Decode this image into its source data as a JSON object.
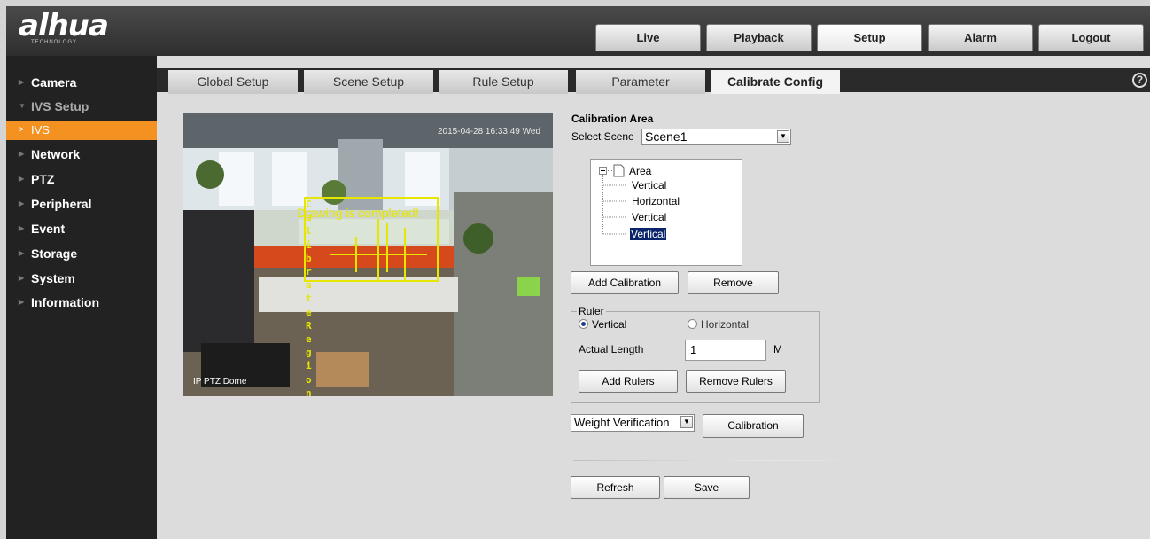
{
  "brand": {
    "logo": "alhua",
    "logo_sub": "TECHNOLOGY"
  },
  "top_nav": [
    "Live",
    "Playback",
    "Setup",
    "Alarm",
    "Logout"
  ],
  "top_nav_active": "Setup",
  "sidebar": {
    "items": [
      {
        "label": "Camera"
      },
      {
        "label": "IVS Setup"
      },
      {
        "label": "IVS"
      },
      {
        "label": "Network"
      },
      {
        "label": "PTZ"
      },
      {
        "label": "Peripheral"
      },
      {
        "label": "Event"
      },
      {
        "label": "Storage"
      },
      {
        "label": "System"
      },
      {
        "label": "Information"
      }
    ]
  },
  "sub_tabs": [
    "Global Setup",
    "Scene Setup",
    "Rule Setup",
    "Parameter",
    "Calibrate Config"
  ],
  "sub_tab_active": "Calibrate Config",
  "video": {
    "timestamp": "2015-04-28 16:33:49 Wed",
    "camera_label": "IP PTZ Dome",
    "overlay_message": "Drawing is completed!",
    "vertical_text": "Calibrate Region"
  },
  "calibration": {
    "title": "Calibration Area",
    "scene_label": "Select Scene",
    "scene_value": "Scene1",
    "tree": {
      "root": "Area",
      "children": [
        "Vertical",
        "Horizontal",
        "Vertical",
        "Vertical"
      ]
    },
    "add_calibration": "Add Calibration",
    "remove": "Remove"
  },
  "ruler": {
    "legend": "Ruler",
    "vertical": "Vertical",
    "horizontal": "Horizontal",
    "selected": "Vertical",
    "length_label": "Actual Length",
    "length_value": "1",
    "unit": "M",
    "add_rulers": "Add Rulers",
    "remove_rulers": "Remove Rulers"
  },
  "verification": {
    "mode": "Weight Verification",
    "calibration_button": "Calibration"
  },
  "footer": {
    "refresh": "Refresh",
    "save": "Save"
  },
  "colors": {
    "accent": "#f39121",
    "overlay": "#e6e600",
    "selection": "#0a246a"
  }
}
